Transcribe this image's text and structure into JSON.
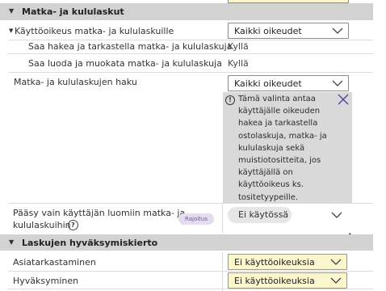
{
  "sections": {
    "travel": {
      "title": "Matka- ja kululaskut"
    },
    "approval": {
      "title": "Laskujen hyväksymiskierto"
    }
  },
  "travel_rights": {
    "label": "Käyttöoikeus matka- ja kululaskuille",
    "value": "Kaikki oikeudet",
    "sub": [
      {
        "label": "Saa hakea ja tarkastella matka- ja kululaskuja",
        "value": "Kyllä"
      },
      {
        "label": "Saa luoda ja muokata matka- ja kululaskuja",
        "value": "Kyllä"
      }
    ]
  },
  "search": {
    "label": "Matka- ja kululaskujen haku",
    "value": "Kaikki oikeudet"
  },
  "info": {
    "text": "Tämä valinta antaa käyttäjälle oikeuden hakea ja tarkastella ostolaskuja, matka- ja kululaskuja sekä muistiotositteita, jos käyttäjällä on käyttöoikeus ks. tositetyypeille."
  },
  "own_only": {
    "label_line1": "Pääsy vain käyttäjän luomiin matka- ja",
    "label_line2": "kululaskuihin",
    "help": "?",
    "tag": "Rajoitus",
    "value": "Ei käytössä"
  },
  "approval": {
    "rows": [
      {
        "label": "Asiatarkastaminen",
        "value": "Ei käyttöoikeuksia"
      },
      {
        "label": "Hyväksyminen",
        "value": "Ei käyttöoikeuksia"
      }
    ]
  },
  "icons": {
    "triangle": "▼",
    "chevron": "chevron-down-icon",
    "info": "!",
    "close": "close-icon"
  },
  "colors": {
    "section_bg": "#d2d2d2",
    "yellow_select": "#fcf6cf",
    "info_bg": "#d9d9d9",
    "close_color": "#5b4aa0",
    "tag_bg": "#e5dcf0"
  }
}
